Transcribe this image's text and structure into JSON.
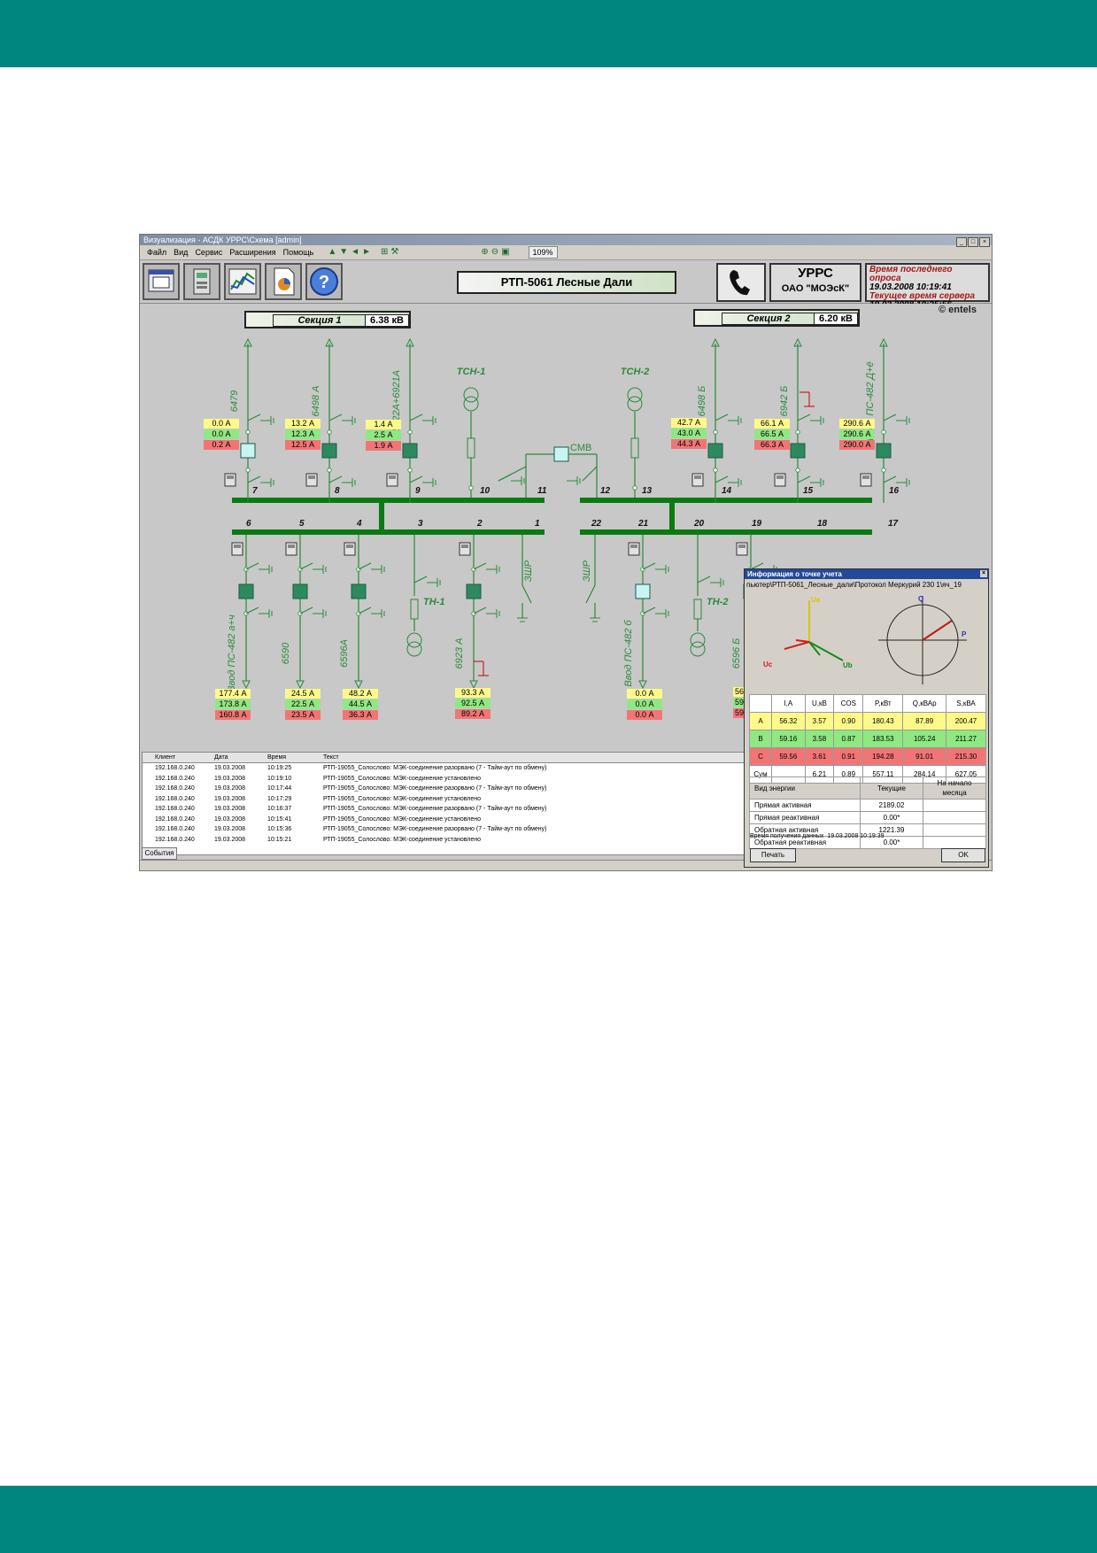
{
  "window": {
    "title": "Визуализация - АСДК УРРС\\Схема [admin]",
    "zoom": "109%",
    "menu": [
      "Файл",
      "Вид",
      "Сервис",
      "Расширения",
      "Помощь"
    ]
  },
  "header": {
    "scheme_title": "РТП-5061 Лесные Дали",
    "org_line1": "УРРС",
    "org_line2": "ОАО \"МОЭсК\"",
    "last_poll_label": "Время последнего опроса",
    "last_poll_value": "19.03.2008 10:19:41",
    "server_time_label": "Текущее время сервера",
    "server_time_value": "19.03.2008 10:25:56"
  },
  "scheme": {
    "section1": {
      "label": "Секция 1",
      "kv": "6.38 кВ"
    },
    "section2": {
      "label": "Секция 2",
      "kv": "6.20 кВ"
    },
    "logo": "© entels",
    "top_feeders": [
      "6479",
      "6498 А",
      "6922А+6921А",
      "6498 Б",
      "6942 Б",
      "Ввод ПС-482 Д+ё"
    ],
    "bottom_feeders": [
      "Ввод ПС-482 а+ч",
      "6590",
      "6596А",
      "6923 А",
      "Ввод ПС-482 б",
      "6596 Б"
    ],
    "tsn1": "ТСН-1",
    "tsn2": "ТСН-2",
    "th1": "ТН-1",
    "th2": "ТН-2",
    "smv": "СМВ",
    "zshr": "ЗШР",
    "top_numbers": [
      "7",
      "8",
      "9",
      "10",
      "11",
      "12",
      "13",
      "14",
      "15",
      "16"
    ],
    "bottom_numbers": [
      "6",
      "5",
      "4",
      "3",
      "2",
      "1",
      "22",
      "21",
      "20",
      "19",
      "18",
      "17"
    ],
    "top_currents": [
      [
        "0.0 А",
        "0.0 А",
        "0.2 А"
      ],
      [
        "13.2 А",
        "12.3 А",
        "12.5 А"
      ],
      [
        "1.4 А",
        "2.5 А",
        "1.9 А"
      ],
      [
        "42.7 А",
        "43.0 А",
        "44.3 А"
      ],
      [
        "66.1 А",
        "66.5 А",
        "66.3 А"
      ],
      [
        "290.6 А",
        "290.6 А",
        "290.0 А"
      ]
    ],
    "bottom_currents": [
      [
        "177.4 А",
        "173.8 А",
        "160.8 А"
      ],
      [
        "24.5 А",
        "22.5 А",
        "23.5 А"
      ],
      [
        "48.2 А",
        "44.5 А",
        "36.3 А"
      ],
      [
        "93.3 А",
        "92.5 А",
        "89.2 А"
      ],
      [
        "0.0 А",
        "0.0 А",
        "0.0 А"
      ],
      [
        "56",
        "59",
        "59"
      ]
    ]
  },
  "events": {
    "headers": [
      "Клиент",
      "Дата",
      "Время",
      "Текст"
    ],
    "rows": [
      [
        "192.168.0.240",
        "19.03.2008",
        "10:19:25",
        "РТП-19055_Солослово: МЭК-соединение разорвано (7 - Тайм-аут по обмену)"
      ],
      [
        "192.168.0.240",
        "19.03.2008",
        "10:19:10",
        "РТП-19055_Солослово: МЭК-соединение установлено"
      ],
      [
        "192.168.0.240",
        "19.03.2008",
        "10:17:44",
        "РТП-19055_Солослово: МЭК-соединение разорвано (7 - Тайм-аут по обмену)"
      ],
      [
        "192.168.0.240",
        "19.03.2008",
        "10:17:29",
        "РТП-19055_Солослово: МЭК-соединение установлено"
      ],
      [
        "192.168.0.240",
        "19.03.2008",
        "10:16:37",
        "РТП-19055_Солослово: МЭК-соединение разорвано (7 - Тайм-аут по обмену)"
      ],
      [
        "192.168.0.240",
        "19.03.2008",
        "10:15:41",
        "РТП-19055_Солослово: МЭК-соединение установлено"
      ],
      [
        "192.168.0.240",
        "19.03.2008",
        "10:15:36",
        "РТП-19055_Солослово: МЭК-соединение разорвано (7 - Тайм-аут по обмену)"
      ],
      [
        "192.168.0.240",
        "19.03.2008",
        "10:15:21",
        "РТП-19055_Солослово: МЭК-соединение установлено"
      ]
    ],
    "tab": "События"
  },
  "info_window": {
    "title": "Информация о точке учета",
    "path": "пьютер\\РТП-5061_Лесные_дали\\Протокол Меркурий 230 1\\яч_19",
    "vector_labels": {
      "ua": "Ua",
      "ub": "Ub",
      "uc": "Uc",
      "q": "Q",
      "p": "P"
    },
    "phase_headers": [
      "",
      "I,A",
      "U,кВ",
      "COS",
      "P,кВт",
      "Q,кВАр",
      "S,кВА"
    ],
    "phase_rows": [
      [
        "A",
        "56.32",
        "3.57",
        "0.90",
        "180.43",
        "87.89",
        "200.47"
      ],
      [
        "B",
        "59.16",
        "3.58",
        "0.87",
        "183.53",
        "105.24",
        "211.27"
      ],
      [
        "C",
        "59.56",
        "3.61",
        "0.91",
        "194.28",
        "91.01",
        "215.30"
      ],
      [
        "Сум",
        "",
        "6.21",
        "0.89",
        "557.11",
        "284.14",
        "627.05"
      ]
    ],
    "energy_headers": [
      "Вид энергии",
      "Текущие",
      "На начало месяца"
    ],
    "energy_rows": [
      [
        "Прямая активная",
        "2189.02",
        ""
      ],
      [
        "Прямая реактивная",
        "0.00*",
        ""
      ],
      [
        "Обратная активная",
        "1221.39",
        ""
      ],
      [
        "Обратная реактивная",
        "0.00*",
        ""
      ]
    ],
    "receive_time_label": "Время получения данных",
    "receive_time_value": "19.03.2008 10:19:39",
    "print_button": "Печать",
    "ok_button": "OK"
  },
  "colors": {
    "band": "#00857f",
    "busbar": "#0b7a12",
    "line": "#2a8a3a",
    "phase_a": "#fff98a",
    "phase_b": "#8fe882",
    "phase_c": "#f27575"
  }
}
